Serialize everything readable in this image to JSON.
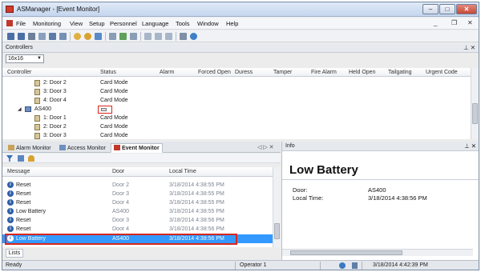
{
  "window": {
    "title": "ASManager - [Event Monitor]",
    "min_glyph": "–",
    "max_glyph": "□",
    "close_glyph": "✕"
  },
  "menu": {
    "items": [
      "File",
      "Monitoring",
      "View",
      "Setup",
      "Personnel",
      "Language",
      "Tools",
      "Window",
      "Help"
    ],
    "mdi_min": "_",
    "mdi_restore": "❐",
    "mdi_close": "✕"
  },
  "controllers_pane": {
    "title": "Controllers",
    "pin_close": "⊥ ✕",
    "filter_value": "16x16",
    "columns": [
      "Controller",
      "Status",
      "Alarm",
      "Forced Open",
      "Duress",
      "Tamper",
      "Fire Alarm",
      "Held Open",
      "Tailgating",
      "Urgent Code"
    ],
    "rows": [
      {
        "name": "2: Door 2",
        "status": "Card Mode",
        "type": "door"
      },
      {
        "name": "3: Door 3",
        "status": "Card Mode",
        "type": "door"
      },
      {
        "name": "4: Door 4",
        "status": "Card Mode",
        "type": "door"
      },
      {
        "name": "AS400",
        "status": "",
        "type": "controller"
      },
      {
        "name": "1: Door 1",
        "status": "Card Mode",
        "type": "door"
      },
      {
        "name": "2: Door 2",
        "status": "Card Mode",
        "type": "door"
      },
      {
        "name": "3: Door 3",
        "status": "Card Mode",
        "type": "door"
      }
    ]
  },
  "tabs": [
    {
      "label": "Alarm Monitor",
      "active": false
    },
    {
      "label": "Access Monitor",
      "active": false
    },
    {
      "label": "Event Monitor",
      "active": true
    }
  ],
  "tab_nav": "◁ ▷ ✕",
  "event_monitor": {
    "columns": [
      "Message",
      "Door",
      "Local Time"
    ],
    "rows": [
      {
        "message": "Reset",
        "door": "Door 2",
        "time": "3/18/2014 4:38:55 PM"
      },
      {
        "message": "Reset",
        "door": "Door 3",
        "time": "3/18/2014 4:38:55 PM"
      },
      {
        "message": "Reset",
        "door": "Door 4",
        "time": "3/18/2014 4:38:55 PM"
      },
      {
        "message": "Low Battery",
        "door": "AS400",
        "time": "3/18/2014 4:38:55 PM"
      },
      {
        "message": "Reset",
        "door": "Door 3",
        "time": "3/18/2014 4:38:56 PM"
      },
      {
        "message": "Reset",
        "door": "Door 4",
        "time": "3/18/2014 4:38:56 PM"
      },
      {
        "message": "Low Battery",
        "door": "AS400",
        "time": "3/18/2014 4:38:56 PM"
      }
    ],
    "selected_index": 6,
    "lists_tab": "Lists"
  },
  "info_pane": {
    "header": "Info",
    "pin_close": "⊥ ✕",
    "title": "Low Battery",
    "door_label": "Door:",
    "door_value": "AS400",
    "time_label": "Local Time:",
    "time_value": "3/18/2014 4:38:56 PM"
  },
  "status_bar": {
    "status": "Ready",
    "operator": "Operator 1",
    "datetime": "3/18/2014 4:42:39 PM"
  },
  "colors": {
    "highlight": "#d9261c",
    "selection": "#3399ff"
  }
}
